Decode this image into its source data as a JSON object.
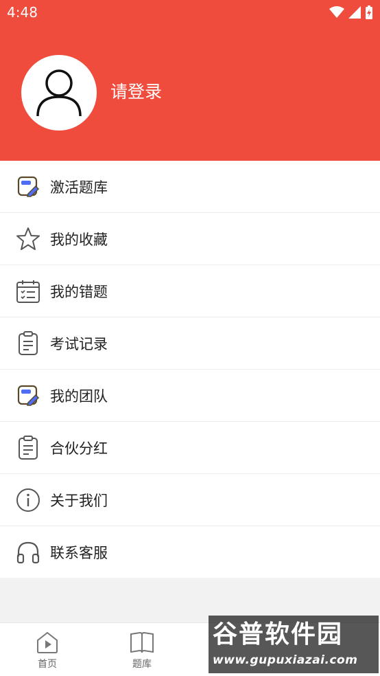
{
  "status_bar": {
    "time": "4:48"
  },
  "profile": {
    "login_label": "请登录"
  },
  "menu": {
    "items": [
      {
        "label": "激活题库",
        "icon": "edit-card-icon"
      },
      {
        "label": "我的收藏",
        "icon": "star-icon"
      },
      {
        "label": "我的错题",
        "icon": "calendar-list-icon"
      },
      {
        "label": "考试记录",
        "icon": "clipboard-icon"
      },
      {
        "label": "我的团队",
        "icon": "edit-card-icon"
      },
      {
        "label": "合伙分红",
        "icon": "clipboard-icon"
      },
      {
        "label": "关于我们",
        "icon": "info-icon"
      },
      {
        "label": "联系客服",
        "icon": "headphones-icon"
      }
    ]
  },
  "bottom_nav": {
    "items": [
      {
        "label": "首页",
        "icon": "home-play-icon"
      },
      {
        "label": "题库",
        "icon": "book-icon"
      },
      {
        "label": "",
        "icon": "unknown-icon"
      },
      {
        "label": "",
        "icon": "unknown-icon"
      }
    ]
  },
  "watermark": {
    "title": "谷普软件园",
    "url": "www.gupuxiazai.com"
  },
  "colors": {
    "header_bg": "#ef4c3d",
    "icon_accent": "#4f6df5",
    "icon_outline": "#5a5a5a"
  }
}
